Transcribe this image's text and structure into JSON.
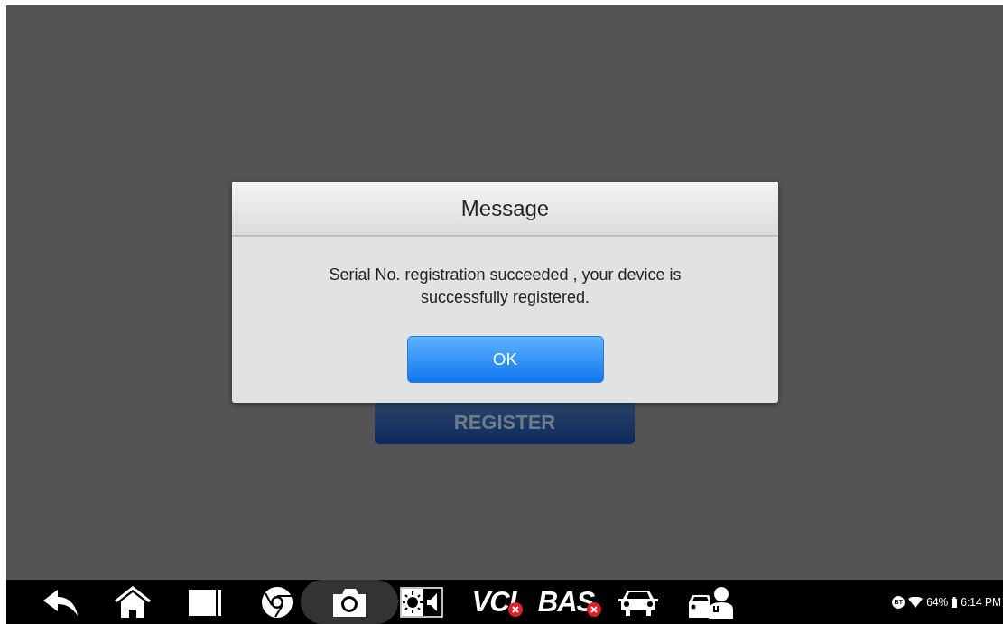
{
  "background": {
    "register_button": "REGISTER"
  },
  "dialog": {
    "title": "Message",
    "message": "Serial No. registration succeeded , your device is successfully registered.",
    "ok_button": "OK"
  },
  "taskbar": [
    {
      "kind": "back",
      "selected": false
    },
    {
      "kind": "home",
      "selected": false
    },
    {
      "kind": "recent",
      "selected": false
    },
    {
      "kind": "browser",
      "selected": false
    },
    {
      "kind": "camera",
      "selected": true
    },
    {
      "kind": "display",
      "selected": false
    },
    {
      "kind": "badge-text",
      "label": "VCI",
      "selected": false
    },
    {
      "kind": "badge-text",
      "label": "BAS",
      "selected": false
    },
    {
      "kind": "car",
      "selected": false
    },
    {
      "kind": "car-tech",
      "selected": false
    }
  ],
  "status_bar": {
    "bluetooth": "BT",
    "battery": "64%",
    "time": "6:14 PM"
  }
}
